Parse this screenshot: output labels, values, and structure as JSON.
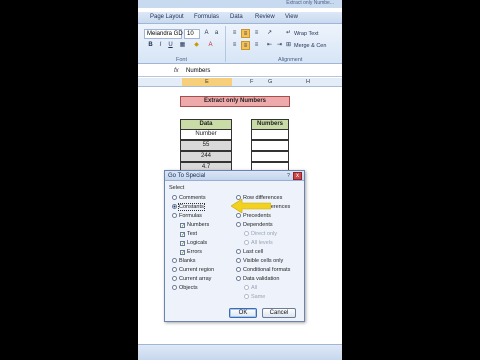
{
  "window": {
    "title": "Extract only Numbe..."
  },
  "ribbon": {
    "tabs": [
      "Page Layout",
      "Formulas",
      "Data",
      "Review",
      "View"
    ],
    "font_name": "Meiandra GD",
    "font_size": "10",
    "wrap_text": "Wrap Text",
    "merge_center": "Merge & Cen",
    "group_font": "Font",
    "group_alignment": "Alignment"
  },
  "formula_bar": {
    "fx": "fx",
    "value": "Numbers"
  },
  "columns": [
    "E",
    "F",
    "G",
    "H"
  ],
  "sheet": {
    "title_cell": "Extract only Numbers",
    "data_header": "Data",
    "numbers_header": "Numbers",
    "data_values": [
      "Number",
      "55",
      "244",
      "4.7",
      ""
    ]
  },
  "dialog": {
    "title": "Go To Special",
    "help": "?",
    "close": "x",
    "select_label": "Select",
    "left_options": [
      {
        "label": "Comments",
        "kind": "radio",
        "checked": false
      },
      {
        "label": "Constants",
        "kind": "radio",
        "checked": true
      },
      {
        "label": "Formulas",
        "kind": "radio",
        "checked": false
      },
      {
        "label": "Numbers",
        "kind": "check",
        "checked": true
      },
      {
        "label": "Text",
        "kind": "check",
        "checked": true
      },
      {
        "label": "Logicals",
        "kind": "check",
        "checked": true
      },
      {
        "label": "Errors",
        "kind": "check",
        "checked": true
      },
      {
        "label": "Blanks",
        "kind": "radio",
        "checked": false
      },
      {
        "label": "Current region",
        "kind": "radio",
        "checked": false
      },
      {
        "label": "Current array",
        "kind": "radio",
        "checked": false
      },
      {
        "label": "Objects",
        "kind": "radio",
        "checked": false
      }
    ],
    "right_options": [
      {
        "label": "Row differences",
        "kind": "radio"
      },
      {
        "label": "Column differences",
        "kind": "radio"
      },
      {
        "label": "Precedents",
        "kind": "radio"
      },
      {
        "label": "Dependents",
        "kind": "radio"
      },
      {
        "label": "Direct only",
        "kind": "radio",
        "disabled": true
      },
      {
        "label": "All levels",
        "kind": "radio",
        "disabled": true
      },
      {
        "label": "Last cell",
        "kind": "radio"
      },
      {
        "label": "Visible cells only",
        "kind": "radio"
      },
      {
        "label": "Conditional formats",
        "kind": "radio"
      },
      {
        "label": "Data validation",
        "kind": "radio"
      },
      {
        "label": "All",
        "kind": "radio",
        "disabled": true
      },
      {
        "label": "Same",
        "kind": "radio",
        "disabled": true
      }
    ],
    "ok": "OK",
    "cancel": "Cancel"
  },
  "colors": {
    "arrow": "#f2d21f",
    "title_fill": "#eeaaaa",
    "header_fill": "#c9dca8"
  }
}
